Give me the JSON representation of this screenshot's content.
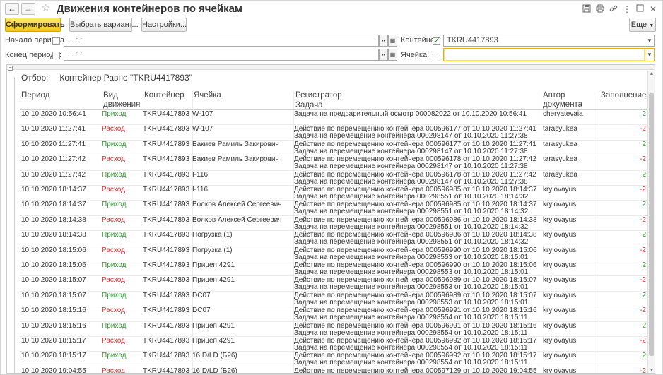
{
  "window": {
    "title": "Движения контейнеров по ячейкам"
  },
  "nav": {
    "back": "←",
    "forward": "→",
    "star": "☆"
  },
  "title_icons": [
    "save-icon",
    "print-icon",
    "link-icon",
    "more-icon",
    "maximize-icon",
    "close-icon"
  ],
  "toolbar": {
    "generate_label": "Сформировать",
    "variant_label": "Выбрать вариант...",
    "settings_label": "Настройки...",
    "more_label": "Еще"
  },
  "params": {
    "period_start_label": "Начало периода:",
    "period_start_value": " .  .      :  :",
    "period_end_label": "Конец периода:",
    "period_end_value": " .  .      :  :",
    "container_label": "Контейнер:",
    "container_value": "TKRU4417893",
    "cell_label": "Ячейка:",
    "cell_value": ""
  },
  "report": {
    "filter_label": "Отбор:",
    "filter_value": "Контейнер Равно \"TKRU4417893\"",
    "columns": {
      "period": "Период",
      "movement_type": "Вид движения",
      "container": "Контейнер",
      "cell": "Ячейка",
      "registrar": "Регистратор",
      "task": "Задача",
      "author": "Автор документа",
      "fill": "Заполнение"
    },
    "rows": [
      {
        "period": "10.10.2020 10:56:41",
        "type": "Приход",
        "dir": "in",
        "container": "TKRU4417893",
        "cell": "W-107",
        "registrar": "Задача на предварительный осмотр 000082022 от 10.10.2020 10:56:41",
        "task": "",
        "author": "cheryatevaia",
        "fill": "2"
      },
      {
        "period": "10.10.2020 11:27:41",
        "type": "Расход",
        "dir": "out",
        "container": "TKRU4417893",
        "cell": "W-107",
        "registrar": "Действие по перемещению контейнера 000596177 от 10.10.2020 11:27:41",
        "task": "Задача на перемещение контейнера 000298147 от 10.10.2020 11:27:38",
        "author": "tarasyukea",
        "fill": "-2"
      },
      {
        "period": "10.10.2020 11:27:41",
        "type": "Приход",
        "dir": "in",
        "container": "TKRU4417893",
        "cell": "Бакиев Рамиль Закирович",
        "registrar": "Действие по перемещению контейнера 000596177 от 10.10.2020 11:27:41",
        "task": "Задача на перемещение контейнера 000298147 от 10.10.2020 11:27:38",
        "author": "tarasyukea",
        "fill": "2"
      },
      {
        "period": "10.10.2020 11:27:42",
        "type": "Расход",
        "dir": "out",
        "container": "TKRU4417893",
        "cell": "Бакиев Рамиль Закирович",
        "registrar": "Действие по перемещению контейнера 000596178 от 10.10.2020 11:27:42",
        "task": "Задача на перемещение контейнера 000298147 от 10.10.2020 11:27:38",
        "author": "tarasyukea",
        "fill": "-2"
      },
      {
        "period": "10.10.2020 11:27:42",
        "type": "Приход",
        "dir": "in",
        "container": "TKRU4417893",
        "cell": "I-116",
        "registrar": "Действие по перемещению контейнера 000596178 от 10.10.2020 11:27:42",
        "task": "Задача на перемещение контейнера 000298147 от 10.10.2020 11:27:38",
        "author": "tarasyukea",
        "fill": "2"
      },
      {
        "period": "10.10.2020 18:14:37",
        "type": "Расход",
        "dir": "out",
        "container": "TKRU4417893",
        "cell": "I-116",
        "registrar": "Действие по перемещению контейнера 000596985 от 10.10.2020 18:14:37",
        "task": "Задача на перемещение контейнера 000298551 от 10.10.2020 18:14:32",
        "author": "krylovayus",
        "fill": "-2"
      },
      {
        "period": "10.10.2020 18:14:37",
        "type": "Приход",
        "dir": "in",
        "container": "TKRU4417893",
        "cell": "Волков Алексей Сергеевич",
        "registrar": "Действие по перемещению контейнера 000596985 от 10.10.2020 18:14:37",
        "task": "Задача на перемещение контейнера 000298551 от 10.10.2020 18:14:32",
        "author": "krylovayus",
        "fill": "2"
      },
      {
        "period": "10.10.2020 18:14:38",
        "type": "Расход",
        "dir": "out",
        "container": "TKRU4417893",
        "cell": "Волков Алексей Сергеевич",
        "registrar": "Действие по перемещению контейнера 000596986 от 10.10.2020 18:14:38",
        "task": "Задача на перемещение контейнера 000298551 от 10.10.2020 18:14:32",
        "author": "krylovayus",
        "fill": "-2"
      },
      {
        "period": "10.10.2020 18:14:38",
        "type": "Приход",
        "dir": "in",
        "container": "TKRU4417893",
        "cell": "Погрузка (1)",
        "registrar": "Действие по перемещению контейнера 000596986 от 10.10.2020 18:14:38",
        "task": "Задача на перемещение контейнера 000298551 от 10.10.2020 18:14:32",
        "author": "krylovayus",
        "fill": "2"
      },
      {
        "period": "10.10.2020 18:15:06",
        "type": "Расход",
        "dir": "out",
        "container": "TKRU4417893",
        "cell": "Погрузка (1)",
        "registrar": "Действие по перемещению контейнера 000596990 от 10.10.2020 18:15:06",
        "task": "Задача на перемещение контейнера 000298553 от 10.10.2020 18:15:01",
        "author": "krylovayus",
        "fill": "-2"
      },
      {
        "period": "10.10.2020 18:15:06",
        "type": "Приход",
        "dir": "in",
        "container": "TKRU4417893",
        "cell": "Прицеп 4291",
        "registrar": "Действие по перемещению контейнера 000596990 от 10.10.2020 18:15:06",
        "task": "Задача на перемещение контейнера 000298553 от 10.10.2020 18:15:01",
        "author": "krylovayus",
        "fill": "2"
      },
      {
        "period": "10.10.2020 18:15:07",
        "type": "Расход",
        "dir": "out",
        "container": "TKRU4417893",
        "cell": "Прицеп 4291",
        "registrar": "Действие по перемещению контейнера 000596989 от 10.10.2020 18:15:07",
        "task": "Задача на перемещение контейнера 000298553 от 10.10.2020 18:15:01",
        "author": "krylovayus",
        "fill": "-2"
      },
      {
        "period": "10.10.2020 18:15:07",
        "type": "Приход",
        "dir": "in",
        "container": "TKRU4417893",
        "cell": "DC07",
        "registrar": "Действие по перемещению контейнера 000596989 от 10.10.2020 18:15:07",
        "task": "Задача на перемещение контейнера 000298553 от 10.10.2020 18:15:01",
        "author": "krylovayus",
        "fill": "2"
      },
      {
        "period": "10.10.2020 18:15:16",
        "type": "Расход",
        "dir": "out",
        "container": "TKRU4417893",
        "cell": "DC07",
        "registrar": "Действие по перемещению контейнера 000596991 от 10.10.2020 18:15:16",
        "task": "Задача на перемещение контейнера 000298554 от 10.10.2020 18:15:11",
        "author": "krylovayus",
        "fill": "-2"
      },
      {
        "period": "10.10.2020 18:15:16",
        "type": "Приход",
        "dir": "in",
        "container": "TKRU4417893",
        "cell": "Прицеп 4291",
        "registrar": "Действие по перемещению контейнера 000596991 от 10.10.2020 18:15:16",
        "task": "Задача на перемещение контейнера 000298554 от 10.10.2020 18:15:11",
        "author": "krylovayus",
        "fill": "2"
      },
      {
        "period": "10.10.2020 18:15:17",
        "type": "Расход",
        "dir": "out",
        "container": "TKRU4417893",
        "cell": "Прицеп 4291",
        "registrar": "Действие по перемещению контейнера 000596992 от 10.10.2020 18:15:17",
        "task": "Задача на перемещение контейнера 000298554 от 10.10.2020 18:15:11",
        "author": "krylovayus",
        "fill": "-2"
      },
      {
        "period": "10.10.2020 18:15:17",
        "type": "Приход",
        "dir": "in",
        "container": "TKRU4417893",
        "cell": "16 D/LD (Б26)",
        "registrar": "Действие по перемещению контейнера 000596992 от 10.10.2020 18:15:17",
        "task": "Задача на перемещение контейнера 000298554 от 10.10.2020 18:15:11",
        "author": "krylovayus",
        "fill": "2"
      },
      {
        "period": "10.10.2020 19:04:55",
        "type": "Расход",
        "dir": "out",
        "container": "TKRU4417893",
        "cell": "16 D/LD (Б26)",
        "registrar": "Действие по перемещению контейнера 000597129 от 10.10.2020 19:04:55",
        "task": "",
        "author": "krylovayus",
        "fill": "-2"
      }
    ]
  }
}
